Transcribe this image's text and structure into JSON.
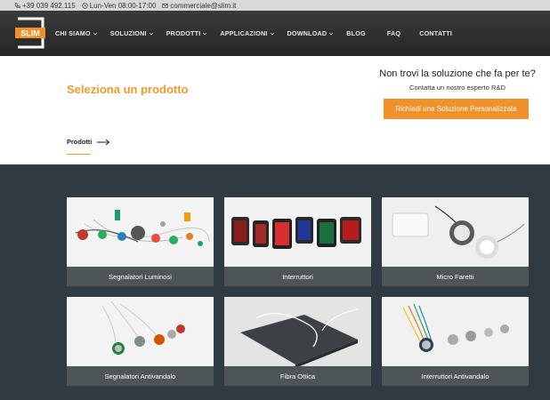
{
  "topbar": {
    "phone": "+39 039 492.115",
    "hours": "Lun-Ven 08:00-17:00",
    "email": "commerciale@slim.it"
  },
  "logo": {
    "text": "SLIM"
  },
  "nav": {
    "items": [
      {
        "label": "CHI SIAMO",
        "dropdown": true
      },
      {
        "label": "SOLUZIONI",
        "dropdown": true
      },
      {
        "label": "PRODOTTI",
        "dropdown": true
      },
      {
        "label": "APPLICAZIONI",
        "dropdown": true
      },
      {
        "label": "DOWNLOAD",
        "dropdown": true
      },
      {
        "label": "BLOG",
        "dropdown": false
      },
      {
        "label": "FAQ",
        "dropdown": false
      },
      {
        "label": "CONTATTI",
        "dropdown": false
      }
    ]
  },
  "hero": {
    "title": "Seleziona un prodotto",
    "cta_question": "Non trovi la soluzione che fa per te?",
    "cta_sub": "Contatta un nostro esperto R&D",
    "cta_button": "Richiedi una Soluzione Personalizzata",
    "breadcrumb": "Prodotti"
  },
  "products": [
    {
      "label": "Segnalatori Luminosi"
    },
    {
      "label": "Interruttori"
    },
    {
      "label": "Micro Faretti"
    },
    {
      "label": "Segnalatori Antivandalo"
    },
    {
      "label": "Fibra Ottica"
    },
    {
      "label": "Interruttori Antivandalo"
    }
  ],
  "colors": {
    "accent": "#f29a2e",
    "nav_bg": "#2e2e2e",
    "grid_bg": "#2f3a43",
    "card_label_bg": "#4e5559"
  }
}
